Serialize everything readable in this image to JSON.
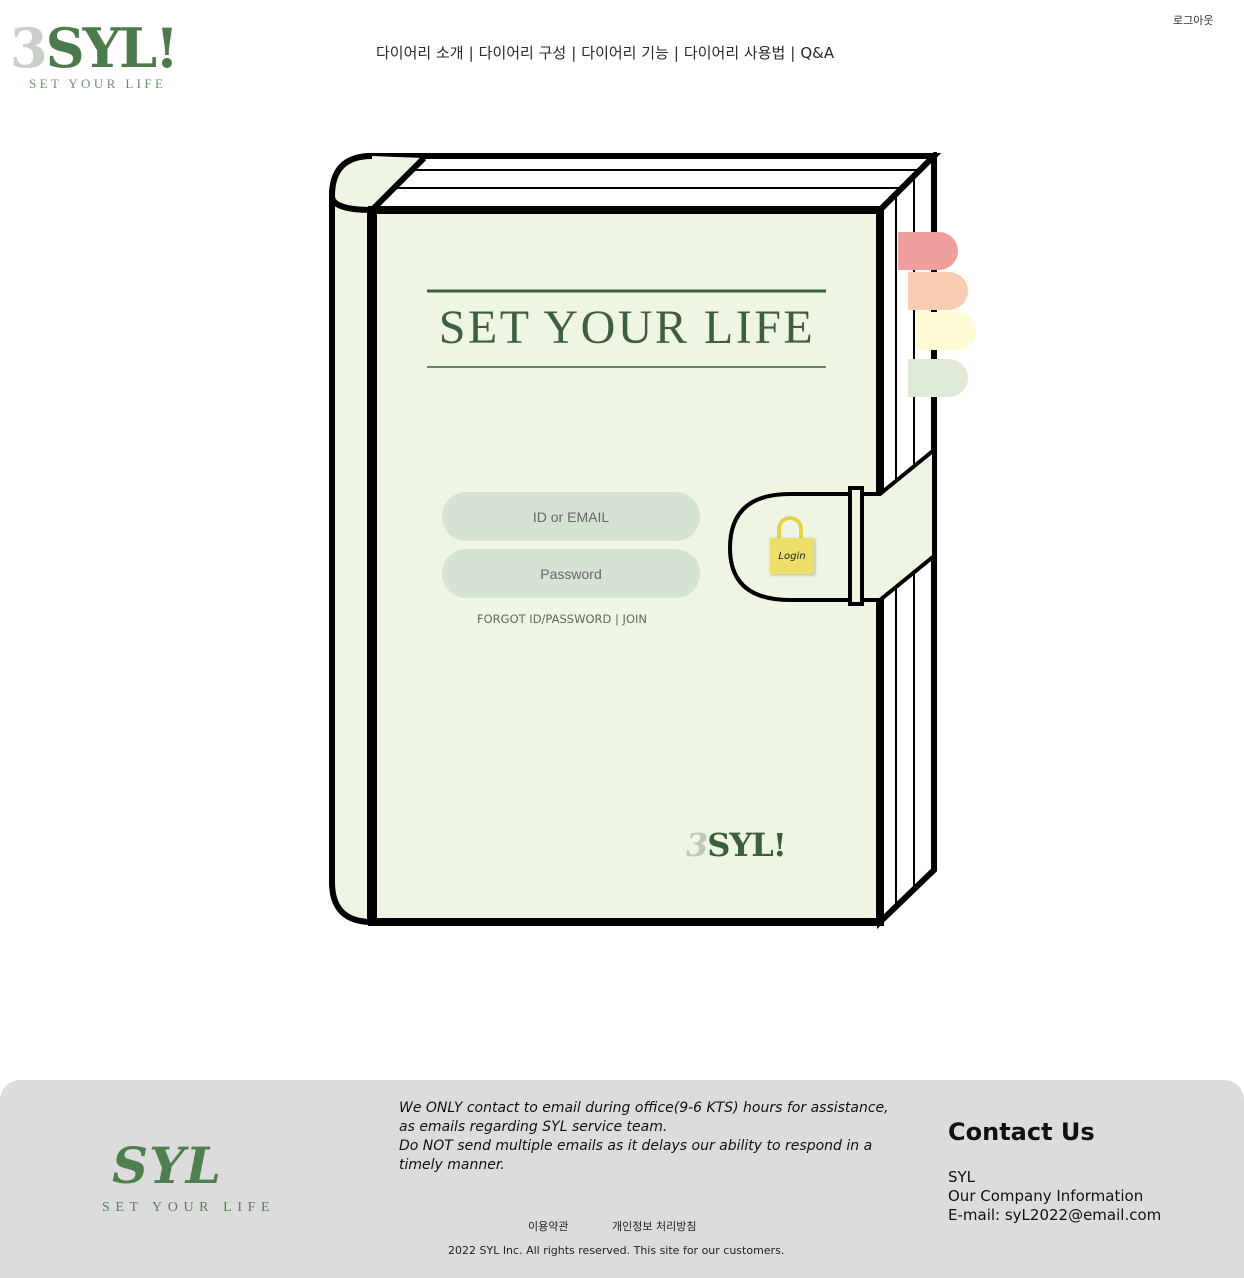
{
  "header": {
    "logo_mark": "3SYL!",
    "logo_tagline": "SET YOUR LIFE",
    "nav": [
      "다이어리 소개",
      "다이어리 구성",
      "다이어리 기능",
      "다이어리 사용법",
      "Q&A"
    ],
    "nav_separator": "|",
    "logout": "로그아웃"
  },
  "diary": {
    "cover_title": "SET YOUR LIFE",
    "id_placeholder": "ID or EMAIL",
    "password_placeholder": "Password",
    "forgot_link": "FORGOT ID/PASSWORD",
    "link_separator": "|",
    "join_link": "JOIN",
    "login_label": "Login",
    "cover_logo": "3SYL!",
    "tab_colors": [
      "#f0a09c",
      "#f8cdb1",
      "#fdfcd6",
      "#dfead6"
    ],
    "cover_color": "#eef5e3",
    "field_color": "#d6e3d4"
  },
  "footer": {
    "logo": "SYL",
    "tagline": "SET YOUR LIFE",
    "notice_lines": [
      "We ONLY contact to email during office(9-6 KTS) hours for assistance,",
      "as emails regarding SYL service team.",
      "Do NOT send multiple emails as it delays our ability to respond in a",
      "timely manner."
    ],
    "terms": "이용약관",
    "privacy": "개인정보 처리방침",
    "copyright": "2022 SYL Inc. All rights reserved. This site for our customers.",
    "contact_title": "Contact Us",
    "contact_lines": [
      "SYL",
      "Our Company Information",
      "E-mail: syL2022@email.com"
    ]
  }
}
